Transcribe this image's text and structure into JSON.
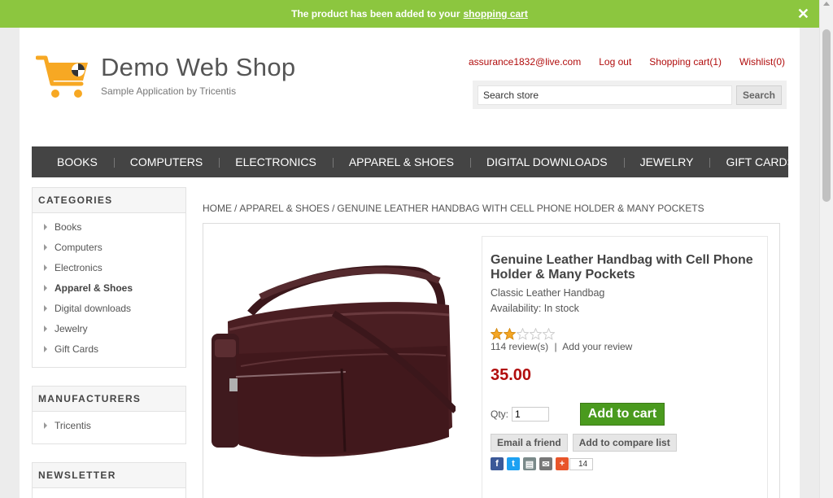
{
  "notification": {
    "message": "The product has been added to your",
    "link_text": "shopping cart",
    "close_symbol": "✕"
  },
  "logo": {
    "title": "Demo Web Shop",
    "tagline": "Sample Application by Tricentis",
    "icon": "shopping-cart-icon",
    "accent_color": "#f7a823"
  },
  "header": {
    "email": "assurance1832@live.com",
    "logout": "Log out",
    "cart": "Shopping cart(1)",
    "wishlist": "Wishlist(0)"
  },
  "search": {
    "value": "Search store",
    "button": "Search"
  },
  "menu": [
    "BOOKS",
    "COMPUTERS",
    "ELECTRONICS",
    "APPAREL & SHOES",
    "DIGITAL DOWNLOADS",
    "JEWELRY",
    "GIFT CARDS"
  ],
  "categories": {
    "title": "CATEGORIES",
    "items": [
      "Books",
      "Computers",
      "Electronics",
      "Apparel & Shoes",
      "Digital downloads",
      "Jewelry",
      "Gift Cards"
    ],
    "active": "Apparel & Shoes"
  },
  "manufacturers": {
    "title": "MANUFACTURERS",
    "items": [
      "Tricentis"
    ]
  },
  "newsletter": {
    "title": "NEWSLETTER"
  },
  "breadcrumb": {
    "home": "HOME",
    "category": "APPAREL & SHOES",
    "current": "GENUINE LEATHER HANDBAG WITH CELL PHONE HOLDER & MANY POCKETS",
    "separator": "/"
  },
  "product": {
    "name": "Genuine Leather Handbag with Cell Phone Holder & Many Pockets",
    "short_description": "Classic Leather Handbag",
    "availability": "Availability: In stock",
    "rating": 2,
    "rating_max": 5,
    "reviews": "114 review(s)",
    "review_separator": "|",
    "add_review": "Add your review",
    "price": "35.00",
    "qty_label": "Qty:",
    "qty_value": "1",
    "add_to_cart": "Add to cart",
    "email_friend": "Email a friend",
    "compare": "Add to compare list",
    "share_count": "14"
  },
  "colors": {
    "notify_green": "#8cc63f",
    "link_red": "#b10d0d",
    "menu_dark": "#444444",
    "cart_green": "#4a9a1e",
    "bag_brown": "#4a1e22"
  },
  "share_icons": [
    "facebook-icon",
    "twitter-icon",
    "print-icon",
    "email-icon",
    "plus-icon"
  ]
}
